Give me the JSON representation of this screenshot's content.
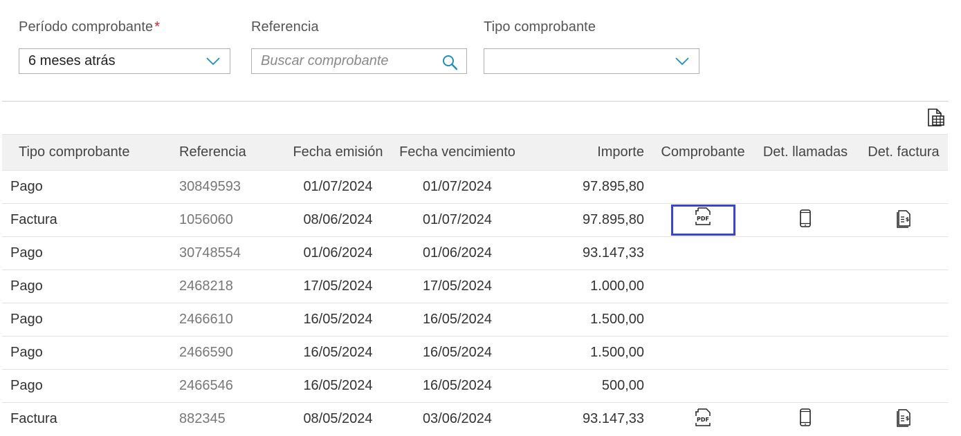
{
  "filters": {
    "periodo": {
      "label": "Período comprobante",
      "required_mark": "*",
      "value": "6 meses atrás"
    },
    "referencia": {
      "label": "Referencia",
      "placeholder": "Buscar comprobante"
    },
    "tipo": {
      "label": "Tipo comprobante",
      "value": ""
    }
  },
  "table": {
    "headers": {
      "tipo": "Tipo comprobante",
      "referencia": "Referencia",
      "fecha_emision": "Fecha emisión",
      "fecha_vencimiento": "Fecha vencimiento",
      "importe": "Importe",
      "comprobante": "Comprobante",
      "det_llamadas": "Det. llamadas",
      "det_factura": "Det. factura"
    },
    "rows": [
      {
        "tipo": "Pago",
        "referencia": "30849593",
        "fecha_emision": "01/07/2024",
        "fecha_vencimiento": "01/07/2024",
        "importe": "97.895,80",
        "icons": false,
        "highlighted": false
      },
      {
        "tipo": "Factura",
        "referencia": "1056060",
        "fecha_emision": "08/06/2024",
        "fecha_vencimiento": "01/07/2024",
        "importe": "97.895,80",
        "icons": true,
        "highlighted": true
      },
      {
        "tipo": "Pago",
        "referencia": "30748554",
        "fecha_emision": "01/06/2024",
        "fecha_vencimiento": "01/06/2024",
        "importe": "93.147,33",
        "icons": false,
        "highlighted": false
      },
      {
        "tipo": "Pago",
        "referencia": "2468218",
        "fecha_emision": "17/05/2024",
        "fecha_vencimiento": "17/05/2024",
        "importe": "1.000,00",
        "icons": false,
        "highlighted": false
      },
      {
        "tipo": "Pago",
        "referencia": "2466610",
        "fecha_emision": "16/05/2024",
        "fecha_vencimiento": "16/05/2024",
        "importe": "1.500,00",
        "icons": false,
        "highlighted": false
      },
      {
        "tipo": "Pago",
        "referencia": "2466590",
        "fecha_emision": "16/05/2024",
        "fecha_vencimiento": "16/05/2024",
        "importe": "1.500,00",
        "icons": false,
        "highlighted": false
      },
      {
        "tipo": "Pago",
        "referencia": "2466546",
        "fecha_emision": "16/05/2024",
        "fecha_vencimiento": "16/05/2024",
        "importe": "500,00",
        "icons": false,
        "highlighted": false
      },
      {
        "tipo": "Factura",
        "referencia": "882345",
        "fecha_emision": "08/05/2024",
        "fecha_vencimiento": "03/06/2024",
        "importe": "93.147,33",
        "icons": true,
        "highlighted": false
      }
    ]
  },
  "icons": {
    "export": "excel-export-icon",
    "comprobante": "pdf-icon",
    "det_llamadas": "mobile-phone-icon",
    "det_factura": "invoice-detail-icon",
    "dropdown": "chevron-down-icon",
    "search": "search-icon"
  },
  "colors": {
    "accent": "#1f8fb5",
    "required": "#c62828",
    "highlight_border": "#3a45c8",
    "header_bg": "#f1f1f1"
  }
}
